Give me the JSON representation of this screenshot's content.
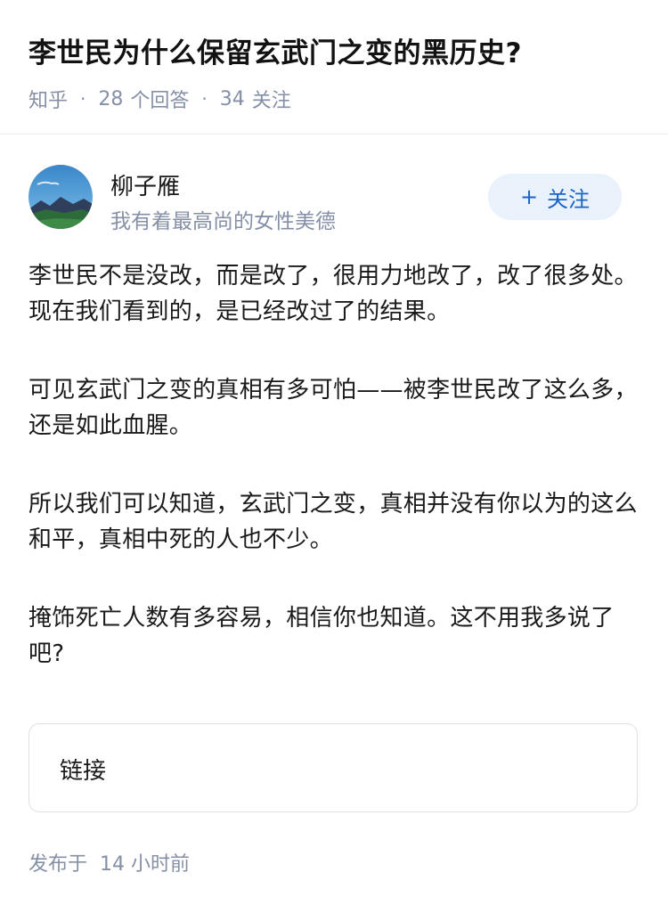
{
  "question": {
    "title": "李世民为什么保留玄武门之变的黑历史?",
    "source": "知乎",
    "answer_count": "28",
    "answer_unit": "个回答",
    "follower_count": "34",
    "follower_unit": "关注"
  },
  "author": {
    "name": "柳子雁",
    "bio": "我有着最高尚的女性美德",
    "follow_label": "关注",
    "follow_plus": "+"
  },
  "answer": {
    "paragraphs": [
      "李世民不是没改，而是改了，很用力地改了，改了很多处。现在我们看到的，是已经改过了的结果。",
      "可见玄武门之变的真相有多可怕——被李世民改了这么多，还是如此血腥。",
      "所以我们可以知道，玄武门之变，真相并没有你以为的这么和平，真相中死的人也不少。",
      "掩饰死亡人数有多容易，相信你也知道。这不用我多说了吧?"
    ]
  },
  "link_card": {
    "label": "链接"
  },
  "footer": {
    "publish_prefix": "发布于",
    "publish_time": "14 小时前"
  },
  "icons": {
    "avatar": "landscape-avatar-icon"
  },
  "colors": {
    "meta_gray": "#8590a6",
    "follow_bg": "#e9f1fb",
    "follow_text": "#1a63c7"
  }
}
